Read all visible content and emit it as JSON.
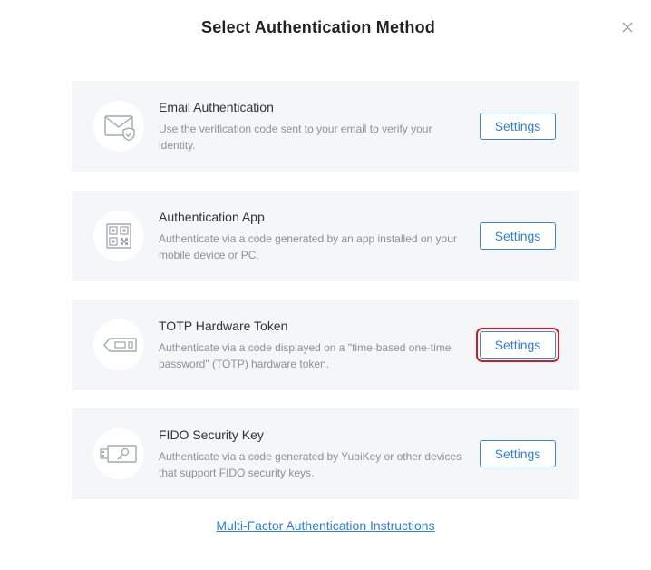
{
  "dialog": {
    "title": "Select Authentication Method",
    "close_icon": "close-icon"
  },
  "methods": [
    {
      "title": "Email Authentication",
      "description": "Use the verification code sent to your email to verify your identity.",
      "button_label": "Settings",
      "icon": "email-shield-icon"
    },
    {
      "title": "Authentication App",
      "description": "Authenticate via a code generated by an app installed on your mobile device or PC.",
      "button_label": "Settings",
      "icon": "qr-code-icon"
    },
    {
      "title": "TOTP Hardware Token",
      "description": "Authenticate via a code displayed on a \"time-based one-time password\" (TOTP) hardware token.",
      "button_label": "Settings",
      "icon": "hardware-token-icon",
      "highlighted": true
    },
    {
      "title": "FIDO Security Key",
      "description": "Authenticate via a code generated by YubiKey or other devices that support FIDO security keys.",
      "button_label": "Settings",
      "icon": "security-key-icon"
    }
  ],
  "footer": {
    "link_text": "Multi-Factor Authentication Instructions"
  },
  "colors": {
    "accent": "#2f7fd4",
    "card_background": "#f5f6f8",
    "highlight_outline": "#cc1f2a"
  }
}
